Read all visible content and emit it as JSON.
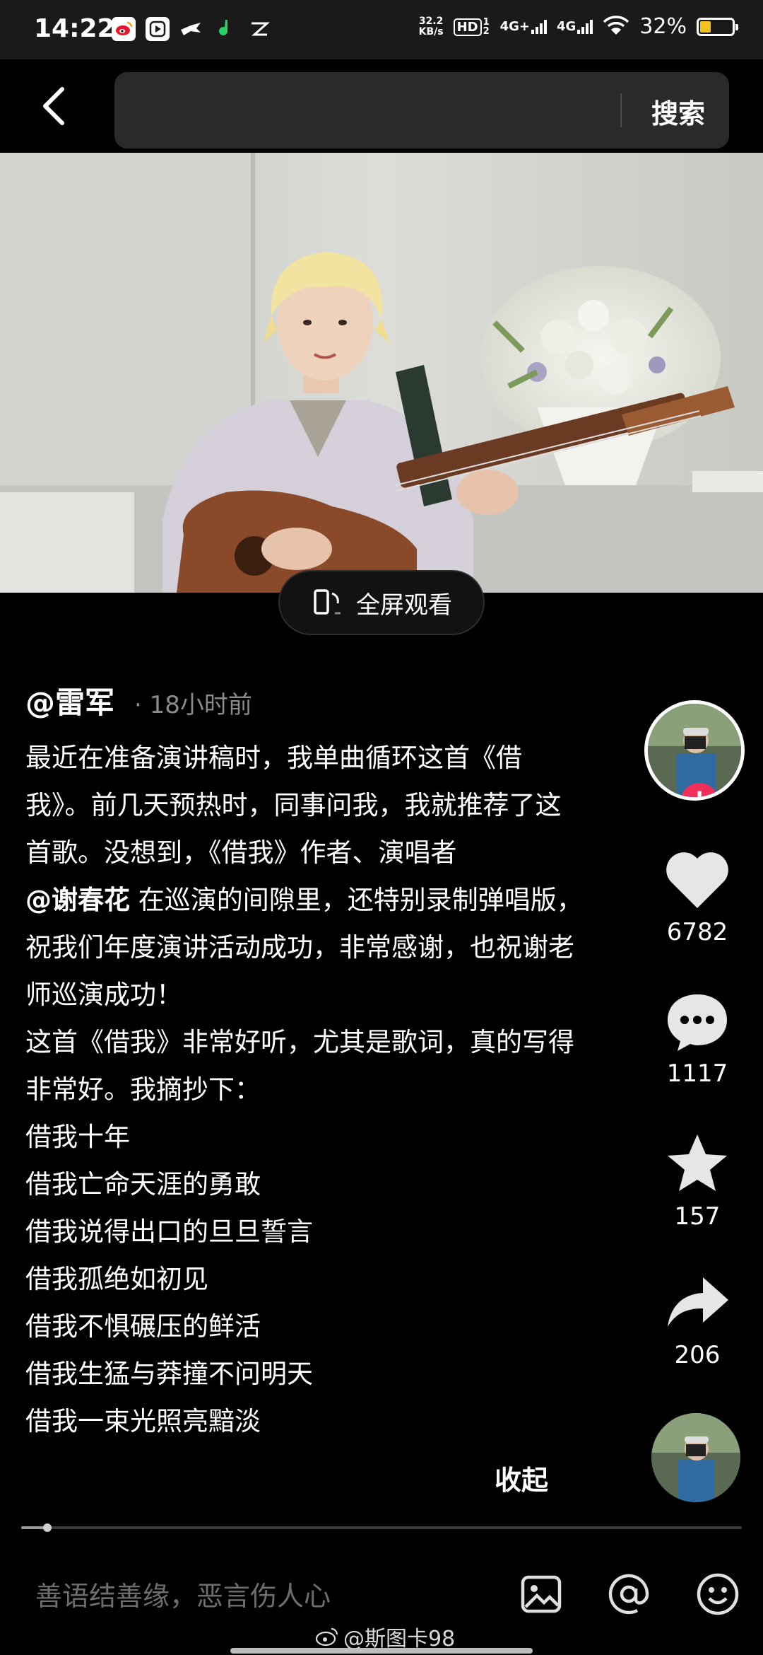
{
  "status_bar": {
    "time": "14:22",
    "net_speed_value": "32.2",
    "net_speed_unit": "KB/s",
    "hd_label": "HD",
    "hd_sim": "1 2",
    "network_1": "4G+",
    "network_2": "4G",
    "battery_percent": "32%",
    "battery_level": 0.32,
    "battery_color": "#f3c220",
    "app_icons": [
      "weibo-icon",
      "video-play-icon",
      "bird-icon",
      "green-app-icon",
      "mail-app-icon"
    ]
  },
  "header": {
    "search_button_label": "搜索",
    "back_icon": "back-arrow-icon"
  },
  "video": {
    "fullscreen_label": "全屏观看"
  },
  "post": {
    "author": "@雷军",
    "time_ago": "· 18小时前",
    "paragraph_1a": "最近在准备演讲稿时，我单曲循环这首《借我》。前几天预热时，同事问我，我就推荐了这首歌。没想到，《借我》作者、演唱者",
    "mention": "@谢春花",
    "paragraph_1b": " 在巡演的间隙里，还特别录制弹唱版，祝我们年度演讲活动成功，非常感谢，也祝谢老师巡演成功！",
    "paragraph_2": "这首《借我》非常好听，尤其是歌词，真的写得非常好。我摘抄下：",
    "lyrics": [
      "借我十年",
      "借我亡命天涯的勇敢",
      "借我说得出口的旦旦誓言",
      "借我孤绝如初见",
      "借我不惧碾压的鲜活",
      "借我生猛与莽撞不问明天",
      "借我一束光照亮黯淡"
    ],
    "collapse_label": "收起"
  },
  "actions": {
    "like_count": "6782",
    "comment_count": "1117",
    "favorite_count": "157",
    "share_count": "206",
    "follow_symbol": "+",
    "follow_color": "#f0305a"
  },
  "progress": {
    "value": 0.036
  },
  "comment_bar": {
    "placeholder": "善语结善缘，恶言伤人心"
  },
  "watermark": {
    "text": "@斯图卡98",
    "icon": "weibo-icon"
  }
}
